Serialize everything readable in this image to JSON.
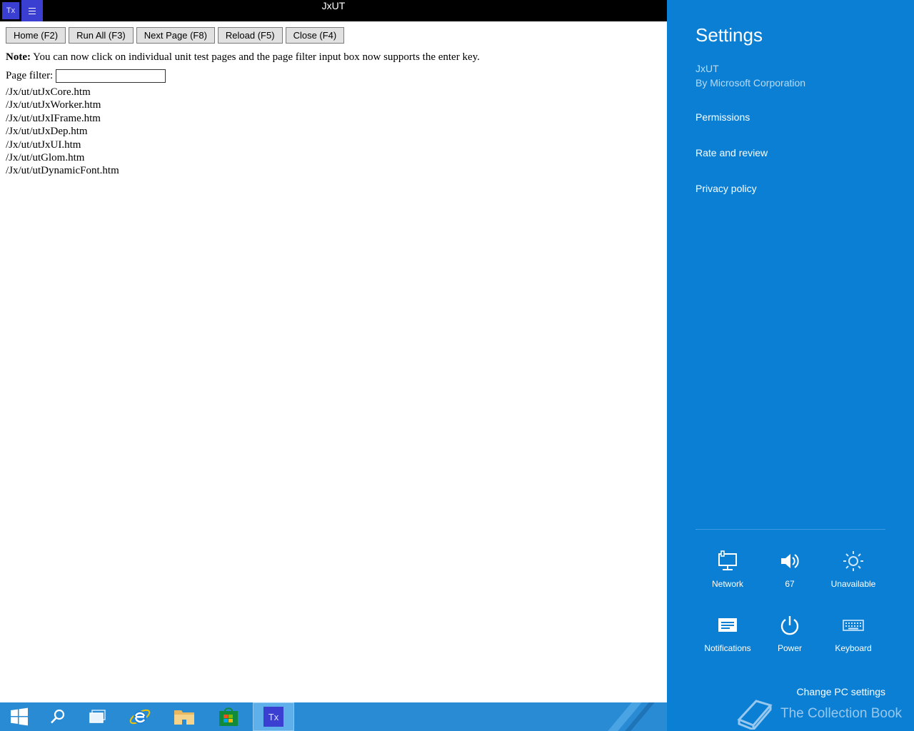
{
  "window": {
    "title": "JxUT",
    "app_badge": "Tx"
  },
  "toolbar": {
    "home": "Home (F2)",
    "run_all": "Run All (F3)",
    "next_page": "Next Page (F8)",
    "reload": "Reload (F5)",
    "close": "Close (F4)"
  },
  "note": {
    "label": "Note:",
    "text": " You can now click on individual unit test pages and the page filter input box now supports the enter key."
  },
  "filter": {
    "label": "Page filter:",
    "value": ""
  },
  "pages": [
    "/Jx/ut/utJxCore.htm",
    "/Jx/ut/utJxWorker.htm",
    "/Jx/ut/utJxIFrame.htm",
    "/Jx/ut/utJxDep.htm",
    "/Jx/ut/utJxUI.htm",
    "/Jx/ut/utGlom.htm",
    "/Jx/ut/utDynamicFont.htm"
  ],
  "settings": {
    "title": "Settings",
    "app_name": "JxUT",
    "publisher": "By Microsoft Corporation",
    "links": [
      "Permissions",
      "Rate and review",
      "Privacy policy"
    ],
    "tiles": {
      "network": "Network",
      "volume": "67",
      "brightness": "Unavailable",
      "notifications": "Notifications",
      "power": "Power",
      "keyboard": "Keyboard"
    },
    "change_pc": "Change PC settings",
    "watermark": "The Collection Book"
  },
  "taskbar": {
    "active_app": "Tx"
  },
  "colors": {
    "charm_bg": "#0a7fd4",
    "taskbar_bg": "#2a8bd5",
    "app_badge": "#3b3fd1"
  }
}
